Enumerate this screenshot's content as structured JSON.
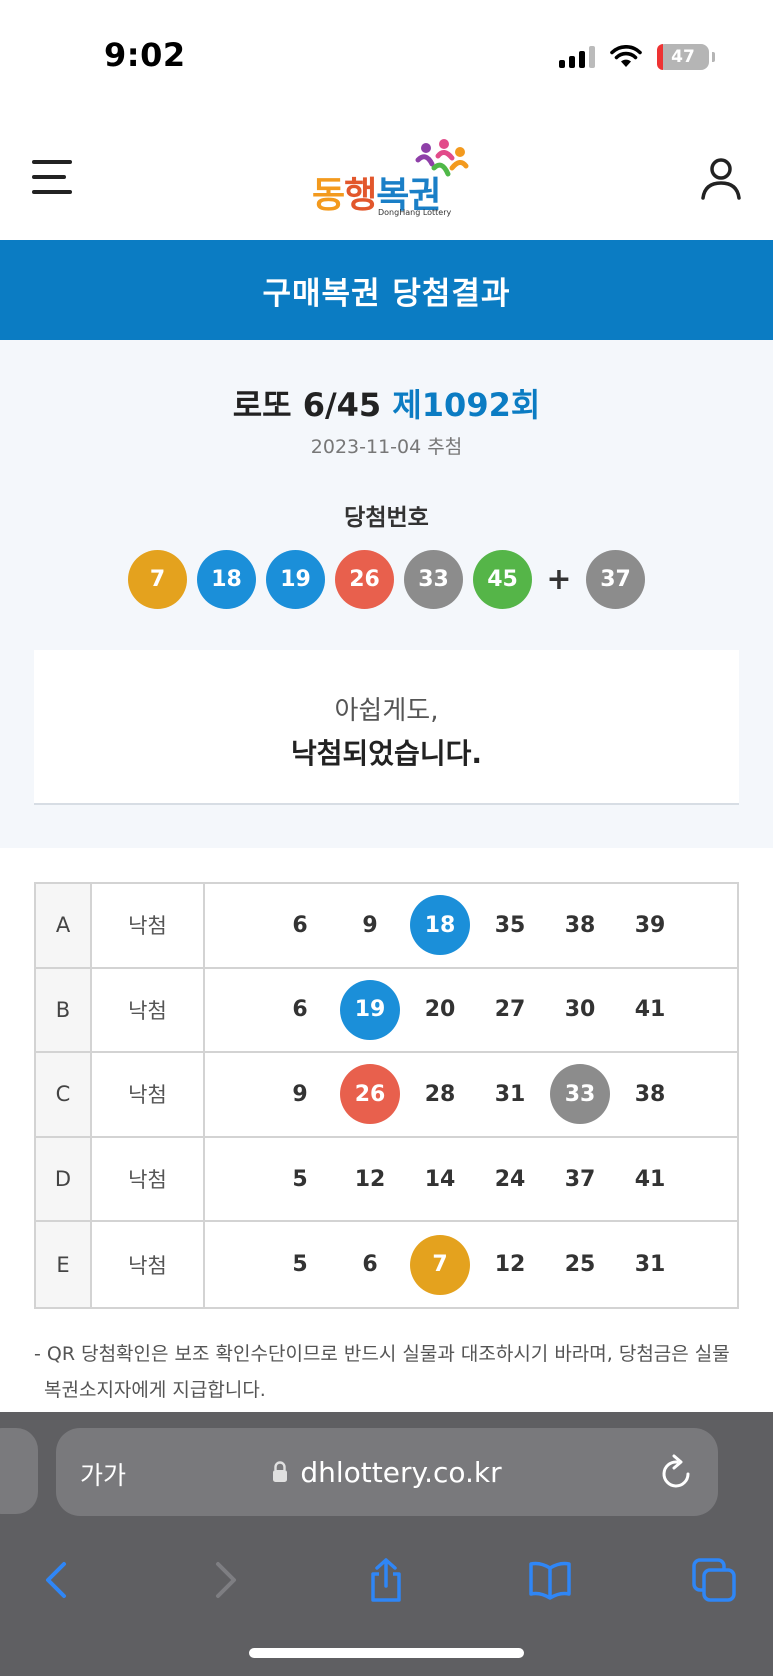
{
  "status_bar": {
    "time": "9:02",
    "battery": "47"
  },
  "header": {
    "logo": {
      "part1": "동",
      "part2": "행",
      "part3": "복권",
      "subtitle": "DongHang Lottery"
    }
  },
  "title_bar": {
    "title": "구매복권 당첨결과"
  },
  "draw": {
    "game": "로또 6/45",
    "round": "제1092회",
    "date": "2023-11-04 추첨",
    "winning_label": "당첨번호",
    "winning_numbers": [
      {
        "value": "7",
        "color": "#e4a21e"
      },
      {
        "value": "18",
        "color": "#1b8fd9"
      },
      {
        "value": "19",
        "color": "#1b8fd9"
      },
      {
        "value": "26",
        "color": "#e8604d"
      },
      {
        "value": "33",
        "color": "#8c8c8c"
      },
      {
        "value": "45",
        "color": "#55b548"
      }
    ],
    "plus": "+",
    "bonus_number": {
      "value": "37",
      "color": "#8c8c8c"
    }
  },
  "result_message": {
    "line1": "아쉽게도,",
    "line2": "낙첨되었습니다."
  },
  "ticket": {
    "rows": [
      {
        "letter": "A",
        "result": "낙첨",
        "numbers": [
          "6",
          "9",
          "18",
          "35",
          "38",
          "39"
        ],
        "hits": {
          "18": "#1b8fd9"
        }
      },
      {
        "letter": "B",
        "result": "낙첨",
        "numbers": [
          "6",
          "19",
          "20",
          "27",
          "30",
          "41"
        ],
        "hits": {
          "19": "#1b8fd9"
        }
      },
      {
        "letter": "C",
        "result": "낙첨",
        "numbers": [
          "9",
          "26",
          "28",
          "31",
          "33",
          "38"
        ],
        "hits": {
          "26": "#e8604d",
          "33": "#8c8c8c"
        }
      },
      {
        "letter": "D",
        "result": "낙첨",
        "numbers": [
          "5",
          "12",
          "14",
          "24",
          "37",
          "41"
        ],
        "hits": {}
      },
      {
        "letter": "E",
        "result": "낙첨",
        "numbers": [
          "5",
          "6",
          "7",
          "12",
          "25",
          "31"
        ],
        "hits": {
          "7": "#e4a21e"
        }
      }
    ]
  },
  "notice": "- QR 당첨확인은 보조 확인수단이므로 반드시 실물과 대조하시기 바라며, 당첨금은 실물 복권소지자에게 지급합니다.",
  "browser": {
    "text_size_label": "가가",
    "url": "dhlottery.co.kr"
  }
}
